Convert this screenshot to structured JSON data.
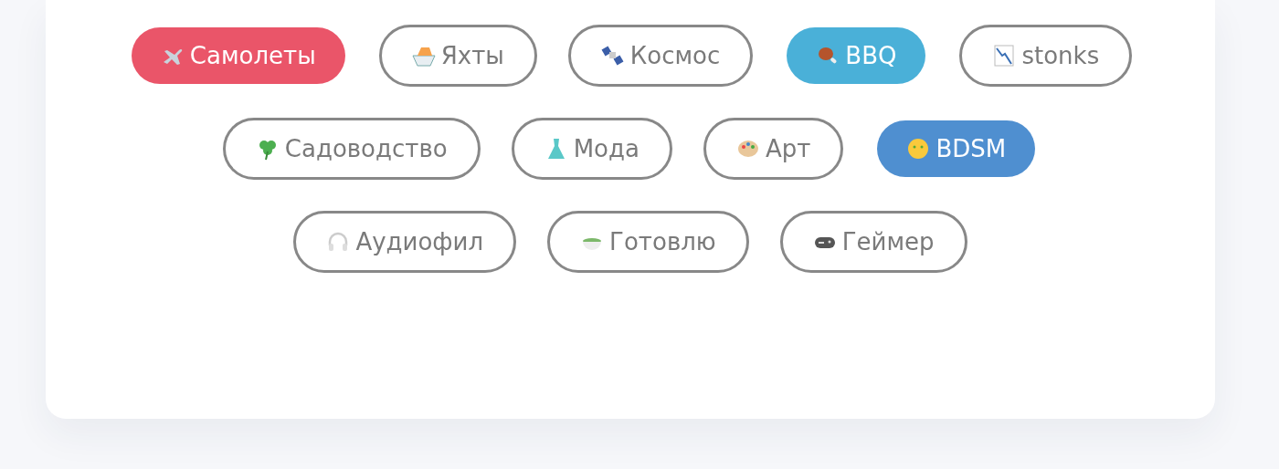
{
  "rows": [
    {
      "chips": [
        {
          "label": "Самолеты",
          "selected": true,
          "color": "#ea5569"
        },
        {
          "label": "Яхты",
          "selected": false
        },
        {
          "label": "Космос",
          "selected": false
        },
        {
          "label": "BBQ",
          "selected": true,
          "color": "#4ab0d8"
        },
        {
          "label": "stonks",
          "selected": false
        }
      ]
    },
    {
      "chips": [
        {
          "label": "Садоводство",
          "selected": false
        },
        {
          "label": "Мода",
          "selected": false
        },
        {
          "label": "Арт",
          "selected": false
        },
        {
          "label": "BDSM",
          "selected": true,
          "color": "#4f8fd0"
        }
      ]
    },
    {
      "chips": [
        {
          "label": "Аудиофил",
          "selected": false
        },
        {
          "label": "Готовлю",
          "selected": false
        },
        {
          "label": "Геймер",
          "selected": false
        }
      ]
    }
  ]
}
